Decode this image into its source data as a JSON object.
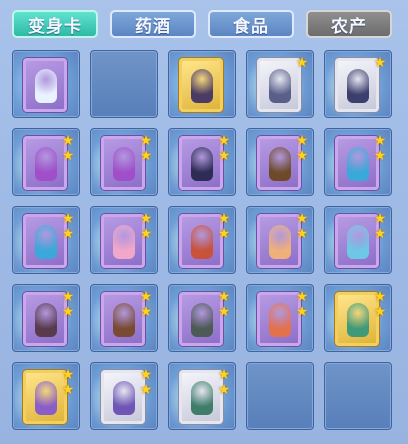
{
  "tabs": [
    {
      "label": "变身卡",
      "active": true
    },
    {
      "label": "药酒",
      "active": false
    },
    {
      "label": "食品",
      "active": false
    },
    {
      "label": "农产",
      "active": false
    }
  ],
  "colors": {
    "active_tab": "#3ccbb7",
    "tab": "#6b94cc",
    "disabled_tab": "#7d7d7d",
    "slot": "#6389c2",
    "star": "#ffd21e"
  },
  "inventory": {
    "rows": 5,
    "columns": 5,
    "slots": [
      {
        "card": "purple",
        "stars": 0,
        "figure": "white-rabbit"
      },
      {
        "card": null
      },
      {
        "card": "gold",
        "stars": 0,
        "figure": "dark-warrior"
      },
      {
        "card": "silver",
        "stars": 1,
        "figure": "armored-knight"
      },
      {
        "card": "silver",
        "stars": 1,
        "figure": "dark-beast"
      },
      {
        "card": "purple",
        "stars": 2,
        "figure": "purple-mage"
      },
      {
        "card": "purple",
        "stars": 2,
        "figure": "purple-mage"
      },
      {
        "card": "purple",
        "stars": 2,
        "figure": "dark-horse"
      },
      {
        "card": "purple",
        "stars": 2,
        "figure": "barbarian"
      },
      {
        "card": "purple",
        "stars": 2,
        "figure": "blue-dragon-girl"
      },
      {
        "card": "purple",
        "stars": 2,
        "figure": "blue-dragon-girl"
      },
      {
        "card": "purple",
        "stars": 2,
        "figure": "pink-fairy"
      },
      {
        "card": "purple",
        "stars": 2,
        "figure": "red-archer"
      },
      {
        "card": "purple",
        "stars": 2,
        "figure": "fox-spirit"
      },
      {
        "card": "purple",
        "stars": 2,
        "figure": "blue-fairy"
      },
      {
        "card": "purple",
        "stars": 2,
        "figure": "dark-rider"
      },
      {
        "card": "purple",
        "stars": 2,
        "figure": "brown-beast"
      },
      {
        "card": "purple",
        "stars": 2,
        "figure": "armored-beast"
      },
      {
        "card": "purple",
        "stars": 2,
        "figure": "fire-fox"
      },
      {
        "card": "gold",
        "stars": 2,
        "figure": "green-sage"
      },
      {
        "card": "gold",
        "stars": 2,
        "figure": "purple-sage"
      },
      {
        "card": "silver",
        "stars": 2,
        "figure": "purple-knight"
      },
      {
        "card": "silver",
        "stars": 2,
        "figure": "green-warrior"
      },
      {
        "card": null
      },
      {
        "card": null
      }
    ]
  }
}
